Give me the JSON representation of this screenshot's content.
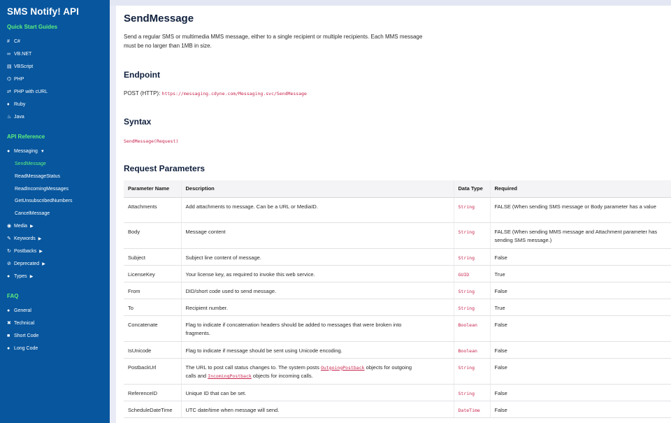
{
  "sidebar": {
    "brand": "SMS Notify! API",
    "quickstart_title": "Quick Start Guides",
    "quickstart": [
      {
        "icon": "#",
        "label": "C#"
      },
      {
        "icon": "∞",
        "label": "VB.NET"
      },
      {
        "icon": "▤",
        "label": "VBScript"
      },
      {
        "icon": "⌬",
        "label": "PHP"
      },
      {
        "icon": "⇄",
        "label": "PHP with cURL"
      },
      {
        "icon": "♦",
        "label": "Ruby"
      },
      {
        "icon": "♨",
        "label": "Java"
      }
    ],
    "api_title": "API Reference",
    "messaging": {
      "icon": "●",
      "label": "Messaging",
      "caret": "▼"
    },
    "messaging_items": [
      "SendMessage",
      "ReadMessageStatus",
      "ReadIncomingMessages",
      "GetUnsubscribedNumbers",
      "CancelMessage"
    ],
    "api_groups": [
      {
        "icon": "◉",
        "label": "Media",
        "caret": "▶"
      },
      {
        "icon": "✎",
        "label": "Keywords",
        "caret": "▶"
      },
      {
        "icon": "↻",
        "label": "Postbacks",
        "caret": "▶"
      },
      {
        "icon": "⊘",
        "label": "Deprecated",
        "caret": "▶"
      },
      {
        "icon": "●",
        "label": "Types",
        "caret": "▶"
      }
    ],
    "faq_title": "FAQ",
    "faq": [
      {
        "icon": "●",
        "label": "General"
      },
      {
        "icon": "✖",
        "label": "Technical"
      },
      {
        "icon": "■",
        "label": "Short Code"
      },
      {
        "icon": "●",
        "label": "Long Code"
      }
    ]
  },
  "page": {
    "title": "SendMessage",
    "intro_line1": "Send a regular SMS or multimedia MMS message, either to a single recipient or multiple recipients. Each MMS message",
    "intro_line2": "must be no larger than 1MB in size.",
    "endpoint_heading": "Endpoint",
    "endpoint_label": "POST (HTTP): ",
    "endpoint_url": "https://messaging.cdyne.com/Messaging.svc/SendMessage",
    "syntax_heading": "Syntax",
    "syntax_code": "SendMessage(Request)",
    "params_heading": "Request Parameters"
  },
  "table": {
    "headers": [
      "Parameter Name",
      "Description",
      "Data Type",
      "Required"
    ],
    "rows": [
      {
        "name": "Attachments",
        "desc": "Add attachments to message. Can be a URL or MediaID.",
        "type": "String",
        "req": "FALSE (When sending SMS message or Body parameter has a value"
      },
      {
        "name": "Body",
        "desc": "Message content",
        "type": "String",
        "req": "FALSE (When sending MMS message and Attachment parameter has",
        "req2": "sending SMS message.)"
      },
      {
        "name": "Subject",
        "desc": "Subject line content of message.",
        "type": "String",
        "req": "False"
      },
      {
        "name": "LicenseKey",
        "desc": "Your license key, as required to invoke this web service.",
        "type": "GUID",
        "req": "True"
      },
      {
        "name": "From",
        "desc": "DID/short code used to send message.",
        "type": "String",
        "req": "False"
      },
      {
        "name": "To",
        "desc": "Recipient number.",
        "type": "String",
        "req": "True"
      },
      {
        "name": "Concatenate",
        "desc": "Flag to indicate if concatenation headers should be added to messages that were broken into",
        "desc2": "fragments.",
        "type": "Boolean",
        "req": "False"
      },
      {
        "name": "IsUnicode",
        "desc": "Flag to indicate if message should be sent using Unicode encoding.",
        "type": "Boolean",
        "req": "False"
      },
      {
        "name": "PostbackUrl",
        "desc": "The URL to post call status changes to. The system posts ",
        "desc_link1": "OutgoingPostback",
        "desc_mid": " objects for outgoing",
        "desc2a": "calls and ",
        "desc_link2": "IncomingPostback",
        "desc2b": " objects for incoming calls.",
        "type": "String",
        "req": "False"
      },
      {
        "name": "ReferenceID",
        "desc": "Unique ID that can be set.",
        "type": "String",
        "req": "False"
      },
      {
        "name": "ScheduleDateTime",
        "desc": "UTC date/time when message will send.",
        "type": "DateTime",
        "req": "False"
      }
    ]
  }
}
